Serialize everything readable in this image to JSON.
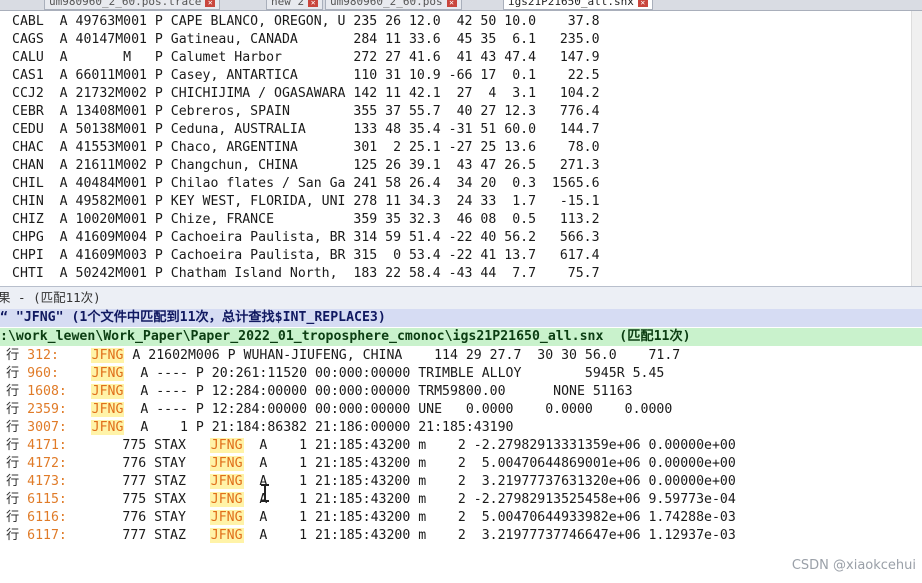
{
  "tabs": [
    {
      "label": "um980960_2_60.pos.trace",
      "active": false
    },
    {
      "label": "new 2",
      "active": false
    },
    {
      "label": "um980960_2_60.pos",
      "active": false
    },
    {
      "label": "igs21P21650_all.snx",
      "active": true
    }
  ],
  "editor_lines": [
    "CABL  A 49763M001 P CAPE BLANCO, OREGON, U 235 26 12.0  42 50 10.0    37.8",
    "CAGS  A 40147M001 P Gatineau, CANADA       284 11 33.6  45 35  6.1   235.0",
    "CALU  A       M   P Calumet Harbor         272 27 41.6  41 43 47.4   147.9",
    "CAS1  A 66011M001 P Casey, ANTARTICA       110 31 10.9 -66 17  0.1    22.5",
    "CCJ2  A 21732M002 P CHICHIJIMA / OGASAWARA 142 11 42.1  27  4  3.1   104.2",
    "CEBR  A 13408M001 P Cebreros, SPAIN        355 37 55.7  40 27 12.3   776.4",
    "CEDU  A 50138M001 P Ceduna, AUSTRALIA      133 48 35.4 -31 51 60.0   144.7",
    "CHAC  A 41553M001 P Chaco, ARGENTINA       301  2 25.1 -27 25 13.6    78.0",
    "CHAN  A 21611M002 P Changchun, CHINA       125 26 39.1  43 47 26.5   271.3",
    "CHIL  A 40484M001 P Chilao flates / San Ga 241 58 26.4  34 20  0.3  1565.6",
    "CHIN  A 49582M001 P KEY WEST, FLORIDA, UNI 278 11 34.3  24 33  1.7   -15.1",
    "CHIZ  A 10020M001 P Chize, FRANCE          359 35 32.3  46 08  0.5   113.2",
    "CHPG  A 41609M004 P Cachoeira Paulista, BR 314 59 51.4 -22 40 56.2   566.3",
    "CHPI  A 41609M003 P Cachoeira Paulista, BR 315  0 53.4 -22 41 13.7   617.4",
    "CHTI  A 50242M001 P Chatham Island North,  183 22 58.4 -43 44  7.7    75.7"
  ],
  "panel_header": "果 - (匹配11次)",
  "search_summary": "“ \"JFNG\" (1个文件中匹配到11次，总计查找$INT_REPLACE3)",
  "file_path": ":\\work_lewen\\Work_Paper\\Paper_2022_01_troposphere_cmonoc\\igs21P21650_all.snx  (匹配11次)",
  "search_term": "JFNG",
  "results": [
    {
      "line": "312:",
      "pre": "  ",
      "post": " A 21602M006 P WUHAN-JIUFENG, CHINA    114 29 27.7  30 30 56.0    71.7"
    },
    {
      "line": "960:",
      "pre": "  ",
      "post": "  A ---- P 20:261:11520 00:000:00000 TRIMBLE ALLOY        5945R 5.45"
    },
    {
      "line": "1608:",
      "pre": "  ",
      "post": "  A ---- P 12:284:00000 00:000:00000 TRM59800.00      NONE 51163"
    },
    {
      "line": "2359:",
      "pre": "  ",
      "post": "  A ---- P 12:284:00000 00:000:00000 UNE   0.0000    0.0000    0.0000"
    },
    {
      "line": "3007:",
      "pre": "  ",
      "post": "  A    1 P 21:184:86382 21:186:00000 21:185:43190"
    },
    {
      "line": "4171:",
      "pre": "      775 STAX   ",
      "post": "  A    1 21:185:43200 m    2 -2.27982913331359e+06 0.00000e+00"
    },
    {
      "line": "4172:",
      "pre": "      776 STAY   ",
      "post": "  A    1 21:185:43200 m    2  5.00470644869001e+06 0.00000e+00"
    },
    {
      "line": "4173:",
      "pre": "      777 STAZ   ",
      "post": "  A    1 21:185:43200 m    2  3.21977737631320e+06 0.00000e+00"
    },
    {
      "line": "6115:",
      "pre": "      775 STAX   ",
      "post": "  A    1 21:185:43200 m    2 -2.27982913525458e+06 9.59773e-04"
    },
    {
      "line": "6116:",
      "pre": "      776 STAY   ",
      "post": "  A    1 21:185:43200 m    2  5.00470644933982e+06 1.74288e-03"
    },
    {
      "line": "6117:",
      "pre": "      777 STAZ   ",
      "post": "  A    1 21:185:43200 m    2  3.21977737746647e+06 1.12937e-03"
    }
  ],
  "row_label": "行",
  "watermark": "CSDN @xiaokcehui"
}
